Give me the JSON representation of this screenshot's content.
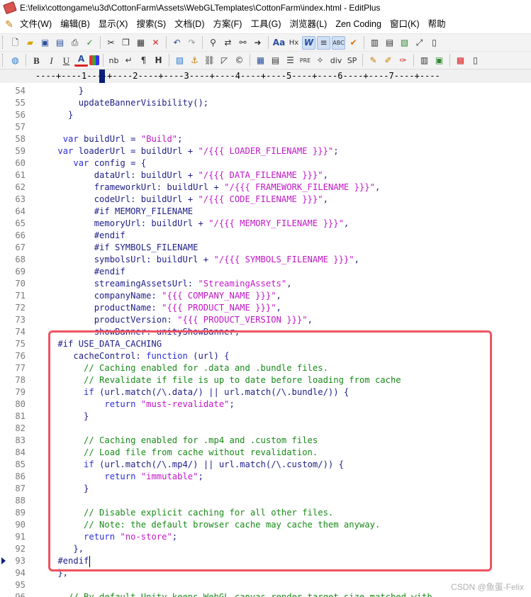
{
  "window": {
    "title": "E:\\felix\\cottongame\\u3d\\CottonFarm\\Assets\\WebGLTemplates\\CottonFarm\\index.html - EditPlus"
  },
  "menu": {
    "items": [
      "文件(W)",
      "编辑(B)",
      "显示(X)",
      "搜索(S)",
      "文档(D)",
      "方案(F)",
      "工具(G)",
      "浏览器(L)",
      "Zen Coding",
      "窗口(K)",
      "帮助"
    ]
  },
  "toolbar1": {
    "icons": [
      "new-file-icon",
      "open-file-icon",
      "save-icon",
      "save-all-icon",
      "print-icon",
      "spell-check-icon",
      "cut-icon",
      "copy-icon",
      "paste-icon",
      "delete-icon",
      "undo-icon",
      "redo-icon",
      "find-icon",
      "replace-icon",
      "find-in-files-icon",
      "goto-icon",
      "font-size-icon",
      "hex-icon",
      "word-wrap-icon",
      "line-number-icon",
      "column-select-icon",
      "check-icon",
      "doc-list-icon",
      "cliptext-icon",
      "directory-icon",
      "fullscreen-icon",
      "dual-view-icon"
    ]
  },
  "toolbar2": {
    "icons": [
      "browser-icon",
      "bold-icon",
      "italic-icon",
      "underline-icon",
      "font-color-icon",
      "highlight-color-icon",
      "nbsp-icon",
      "line-break-icon",
      "paragraph-icon",
      "heading-icon",
      "image-icon",
      "anchor-icon",
      "link-icon",
      "symbol-icon",
      "copyright-icon",
      "table-icon",
      "form-icon",
      "list-icon",
      "pre-icon",
      "comment-icon",
      "div-icon",
      "span-icon",
      "edit-icon",
      "style-icon",
      "css-icon",
      "layout-icon",
      "preview-icon",
      "color-picker-icon",
      "info-icon"
    ],
    "labels": {
      "bold": "B",
      "italic": "I",
      "underline": "U",
      "font_color": "A",
      "nbsp": "nb",
      "line_break": "↵",
      "paragraph": "¶",
      "heading": "H",
      "pre": "PRE",
      "div": "div",
      "span": "SP"
    }
  },
  "ruler": {
    "text": "----+----1----+----2----+----3----+----4----+----5----+----6----+----7----+----"
  },
  "editor": {
    "lines": [
      {
        "n": "54",
        "segs": [
          [
            "plain",
            "        }"
          ]
        ]
      },
      {
        "n": "55",
        "segs": [
          [
            "plain",
            "        updateBannerVisibility();"
          ]
        ]
      },
      {
        "n": "56",
        "segs": [
          [
            "plain",
            "      }"
          ]
        ]
      },
      {
        "n": "57",
        "segs": []
      },
      {
        "n": "58",
        "segs": [
          [
            "plain",
            "     "
          ],
          [
            "kw",
            "var"
          ],
          [
            "plain",
            " buildUrl = "
          ],
          [
            "str",
            "\"Build\""
          ],
          [
            "plain",
            ";"
          ]
        ]
      },
      {
        "n": "59",
        "segs": [
          [
            "plain",
            "    "
          ],
          [
            "kw",
            "var"
          ],
          [
            "plain",
            " loaderUrl = buildUrl + "
          ],
          [
            "str",
            "\"/{{{ LOADER_FILENAME }}}\""
          ],
          [
            "plain",
            ";"
          ]
        ]
      },
      {
        "n": "60",
        "segs": [
          [
            "plain",
            "       "
          ],
          [
            "kw",
            "var"
          ],
          [
            "plain",
            " config = {"
          ]
        ]
      },
      {
        "n": "61",
        "segs": [
          [
            "plain",
            "           dataUrl: buildUrl + "
          ],
          [
            "str",
            "\"/{{{ DATA_FILENAME }}}\""
          ],
          [
            "plain",
            ","
          ]
        ]
      },
      {
        "n": "62",
        "segs": [
          [
            "plain",
            "           frameworkUrl: buildUrl + "
          ],
          [
            "str",
            "\"/{{{ FRAMEWORK_FILENAME }}}\""
          ],
          [
            "plain",
            ","
          ]
        ]
      },
      {
        "n": "63",
        "segs": [
          [
            "plain",
            "           codeUrl: buildUrl + "
          ],
          [
            "str",
            "\"/{{{ CODE_FILENAME }}}\""
          ],
          [
            "plain",
            ","
          ]
        ]
      },
      {
        "n": "64",
        "segs": [
          [
            "plain",
            "           #if MEMORY_FILENAME"
          ]
        ]
      },
      {
        "n": "65",
        "segs": [
          [
            "plain",
            "           memoryUrl: buildUrl + "
          ],
          [
            "str",
            "\"/{{{ MEMORY_FILENAME }}}\""
          ],
          [
            "plain",
            ","
          ]
        ]
      },
      {
        "n": "66",
        "segs": [
          [
            "plain",
            "           #endif"
          ]
        ]
      },
      {
        "n": "67",
        "segs": [
          [
            "plain",
            "           #if SYMBOLS_FILENAME"
          ]
        ]
      },
      {
        "n": "68",
        "segs": [
          [
            "plain",
            "           symbolsUrl: buildUrl + "
          ],
          [
            "str",
            "\"/{{{ SYMBOLS_FILENAME }}}\""
          ],
          [
            "plain",
            ","
          ]
        ]
      },
      {
        "n": "69",
        "segs": [
          [
            "plain",
            "           #endif"
          ]
        ]
      },
      {
        "n": "70",
        "segs": [
          [
            "plain",
            "           streamingAssetsUrl: "
          ],
          [
            "str",
            "\"StreamingAssets\""
          ],
          [
            "plain",
            ","
          ]
        ]
      },
      {
        "n": "71",
        "segs": [
          [
            "plain",
            "           companyName: "
          ],
          [
            "str",
            "\"{{{ COMPANY_NAME }}}\""
          ],
          [
            "plain",
            ","
          ]
        ]
      },
      {
        "n": "72",
        "segs": [
          [
            "plain",
            "           productName: "
          ],
          [
            "str",
            "\"{{{ PRODUCT_NAME }}}\""
          ],
          [
            "plain",
            ","
          ]
        ]
      },
      {
        "n": "73",
        "segs": [
          [
            "plain",
            "           productVersion: "
          ],
          [
            "str",
            "\"{{{ PRODUCT_VERSION }}}\""
          ],
          [
            "plain",
            ","
          ]
        ]
      },
      {
        "n": "74",
        "segs": [
          [
            "plain",
            "           showBanner: unityShowBanner,"
          ]
        ]
      },
      {
        "n": "75",
        "segs": [
          [
            "plain",
            "    #if USE_DATA_CACHING"
          ]
        ]
      },
      {
        "n": "76",
        "segs": [
          [
            "plain",
            "       cacheControl: "
          ],
          [
            "kw",
            "function"
          ],
          [
            "plain",
            " (url) {"
          ]
        ]
      },
      {
        "n": "77",
        "segs": [
          [
            "plain",
            "         "
          ],
          [
            "cmt",
            "// Caching enabled for .data and .bundle files."
          ]
        ]
      },
      {
        "n": "78",
        "segs": [
          [
            "plain",
            "         "
          ],
          [
            "cmt",
            "// Revalidate if file is up to date before loading from cache"
          ]
        ]
      },
      {
        "n": "79",
        "segs": [
          [
            "plain",
            "         "
          ],
          [
            "kw",
            "if"
          ],
          [
            "plain",
            " (url.match(/\\.data/) || url.match(/\\.bundle/)) {"
          ]
        ]
      },
      {
        "n": "80",
        "segs": [
          [
            "plain",
            "             "
          ],
          [
            "kw",
            "return"
          ],
          [
            "plain",
            " "
          ],
          [
            "str",
            "\"must-revalidate\""
          ],
          [
            "plain",
            ";"
          ]
        ]
      },
      {
        "n": "81",
        "segs": [
          [
            "plain",
            "         }"
          ]
        ]
      },
      {
        "n": "82",
        "segs": []
      },
      {
        "n": "83",
        "segs": [
          [
            "plain",
            "         "
          ],
          [
            "cmt",
            "// Caching enabled for .mp4 and .custom files"
          ]
        ]
      },
      {
        "n": "84",
        "segs": [
          [
            "plain",
            "         "
          ],
          [
            "cmt",
            "// Load file from cache without revalidation."
          ]
        ]
      },
      {
        "n": "85",
        "segs": [
          [
            "plain",
            "         "
          ],
          [
            "kw",
            "if"
          ],
          [
            "plain",
            " (url.match(/\\.mp4/) || url.match(/\\.custom/)) {"
          ]
        ]
      },
      {
        "n": "86",
        "segs": [
          [
            "plain",
            "             "
          ],
          [
            "kw",
            "return"
          ],
          [
            "plain",
            " "
          ],
          [
            "str",
            "\"immutable\""
          ],
          [
            "plain",
            ";"
          ]
        ]
      },
      {
        "n": "87",
        "segs": [
          [
            "plain",
            "         }"
          ]
        ]
      },
      {
        "n": "88",
        "segs": []
      },
      {
        "n": "89",
        "segs": [
          [
            "plain",
            "         "
          ],
          [
            "cmt",
            "// Disable explicit caching for all other files."
          ]
        ]
      },
      {
        "n": "90",
        "segs": [
          [
            "plain",
            "         "
          ],
          [
            "cmt",
            "// Note: the default browser cache may cache them anyway."
          ]
        ]
      },
      {
        "n": "91",
        "segs": [
          [
            "plain",
            "         "
          ],
          [
            "kw",
            "return"
          ],
          [
            "plain",
            " "
          ],
          [
            "str",
            "\"no-store\""
          ],
          [
            "plain",
            ";"
          ]
        ]
      },
      {
        "n": "92",
        "segs": [
          [
            "plain",
            "       },"
          ]
        ]
      },
      {
        "n": "93",
        "segs": [
          [
            "plain",
            "    #endif"
          ]
        ]
      },
      {
        "n": "94",
        "segs": [
          [
            "plain",
            "    },"
          ]
        ]
      },
      {
        "n": "95",
        "segs": []
      },
      {
        "n": "96",
        "segs": [
          [
            "plain",
            "      "
          ],
          [
            "cmt",
            "// By default Unity keeps WebGL canvas render target size matched with"
          ]
        ]
      }
    ]
  },
  "watermark": "CSDN @鱼蛋-Felix",
  "colors": {
    "keyword": "#2d2dd8",
    "string": "#c218c8",
    "comment": "#188a18",
    "plain": "#1e1e8a",
    "highlight_box": "#ee5361"
  }
}
